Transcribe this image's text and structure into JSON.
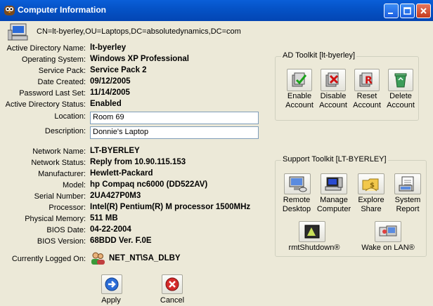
{
  "window": {
    "title": "Computer Information"
  },
  "dn": "CN=lt-byerley,OU=Laptops,DC=absolutedynamics,DC=com",
  "ad_fields": [
    {
      "label": "Active Directory Name:",
      "value": "lt-byerley"
    },
    {
      "label": "Operating System:",
      "value": "Windows XP Professional"
    },
    {
      "label": "Service Pack:",
      "value": "Service Pack 2"
    },
    {
      "label": "Date Created:",
      "value": "09/12/2005"
    },
    {
      "label": "Password Last Set:",
      "value": "11/14/2005"
    },
    {
      "label": "Active Directory Status:",
      "value": "Enabled"
    }
  ],
  "location": {
    "label": "Location:",
    "value": "Room 69"
  },
  "description": {
    "label": "Description:",
    "value": "Donnie's Laptop"
  },
  "net_fields": [
    {
      "label": "Network Name:",
      "value": "LT-BYERLEY"
    },
    {
      "label": "Network Status:",
      "value": "Reply from 10.90.115.153"
    },
    {
      "label": "Manufacturer:",
      "value": "Hewlett-Packard"
    },
    {
      "label": "Model:",
      "value": "hp Compaq nc6000 (DD522AV)"
    },
    {
      "label": "Serial Number:",
      "value": "2UA427P0M3"
    },
    {
      "label": "Processor:",
      "value": "Intel(R) Pentium(R) M processor 1500MHz"
    },
    {
      "label": "Physical Memory:",
      "value": "511 MB"
    },
    {
      "label": "BIOS Date:",
      "value": "04-22-2004"
    },
    {
      "label": "BIOS Version:",
      "value": "68BDD Ver. F.0E"
    }
  ],
  "logged_on": {
    "label": "Currently Logged On:",
    "value": "NET_NT\\SA_DLBY"
  },
  "ad_toolkit": {
    "title": "AD Toolkit [lt-byerley]",
    "buttons": [
      {
        "line1": "Enable",
        "line2": "Account"
      },
      {
        "line1": "Disable",
        "line2": "Account"
      },
      {
        "line1": "Reset",
        "line2": "Account"
      },
      {
        "line1": "Delete",
        "line2": "Account"
      }
    ]
  },
  "support_toolkit": {
    "title": "Support Toolkit [LT-BYERLEY]",
    "buttons": [
      {
        "line1": "Remote",
        "line2": "Desktop"
      },
      {
        "line1": "Manage",
        "line2": "Computer"
      },
      {
        "line1": "Explore",
        "line2": "Share"
      },
      {
        "line1": "System",
        "line2": "Report"
      }
    ],
    "rmt": "rmtShutdown®",
    "wol": "Wake on LAN®"
  },
  "actions": {
    "apply": "Apply",
    "cancel": "Cancel"
  }
}
